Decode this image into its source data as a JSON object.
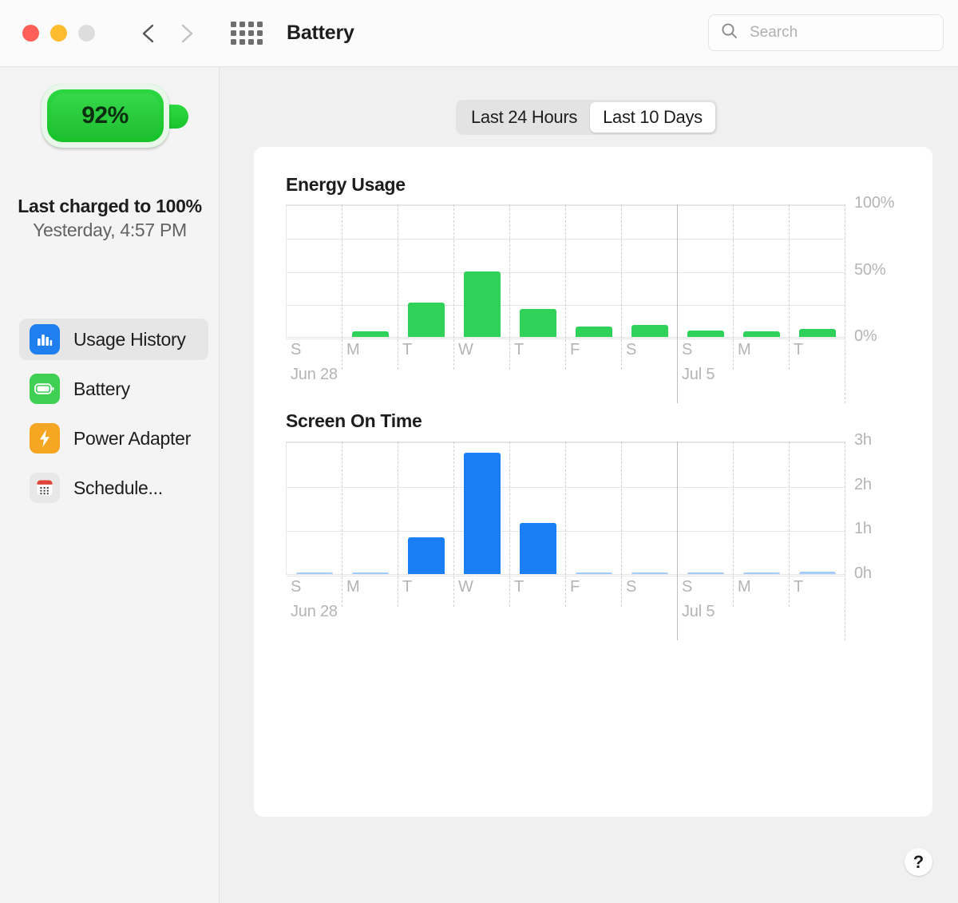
{
  "window": {
    "title": "Battery",
    "traffic_lights": [
      "close",
      "minimize",
      "zoom"
    ],
    "back_icon": "chevron-left-icon",
    "forward_icon": "chevron-right-icon",
    "grid_icon": "app-grid-icon"
  },
  "search": {
    "placeholder": "Search",
    "value": "",
    "icon": "search-icon"
  },
  "sidebar": {
    "battery": {
      "percent_label": "92%",
      "icon": "battery-icon",
      "last_charged_title": "Last charged to 100%",
      "last_charged_time": "Yesterday, 4:57 PM"
    },
    "items": [
      {
        "label": "Usage History",
        "icon": "bar-chart-icon",
        "selected": true,
        "color": "#1f7ef0"
      },
      {
        "label": "Battery",
        "icon": "battery-icon",
        "selected": false,
        "color": "#3ecf53"
      },
      {
        "label": "Power Adapter",
        "icon": "bolt-icon",
        "selected": false,
        "color": "#f5a623"
      },
      {
        "label": "Schedule...",
        "icon": "calendar-icon",
        "selected": false,
        "color": "#e8e8e8"
      }
    ]
  },
  "segmented_control": {
    "options": [
      "Last 24 Hours",
      "Last 10 Days"
    ],
    "selected": "Last 10 Days"
  },
  "help": {
    "label": "?",
    "icon": "help-icon"
  },
  "chart_data": [
    {
      "type": "bar",
      "title": "Energy Usage",
      "categories": [
        "S",
        "M",
        "T",
        "W",
        "T",
        "F",
        "S",
        "S",
        "M",
        "T"
      ],
      "values": [
        0,
        4,
        26,
        49,
        21,
        8,
        9,
        5,
        4,
        6
      ],
      "week_labels": [
        "Jun 28",
        "Jul 5"
      ],
      "week_break_after_index": 6,
      "ylabel": "",
      "xlabel": "",
      "ylim": [
        0,
        100
      ],
      "yticks": [
        0,
        25,
        50,
        75,
        100
      ],
      "ytick_labels": [
        "0%",
        "",
        "50%",
        "",
        "100%"
      ],
      "grid": true,
      "legend": "none",
      "color": "#30d158"
    },
    {
      "type": "bar",
      "title": "Screen On Time",
      "categories": [
        "S",
        "M",
        "T",
        "W",
        "T",
        "F",
        "S",
        "S",
        "M",
        "T"
      ],
      "values": [
        0.01,
        0.01,
        0.82,
        2.73,
        1.15,
        0.01,
        0.01,
        0.01,
        0.01,
        0.06
      ],
      "week_labels": [
        "Jun 28",
        "Jul 5"
      ],
      "week_break_after_index": 6,
      "ylabel": "",
      "xlabel": "",
      "ylim": [
        0,
        3
      ],
      "yticks": [
        0,
        1,
        2,
        3
      ],
      "ytick_labels": [
        "0h",
        "1h",
        "2h",
        "3h"
      ],
      "grid": true,
      "legend": "none",
      "color": "#1a7ef5"
    }
  ]
}
